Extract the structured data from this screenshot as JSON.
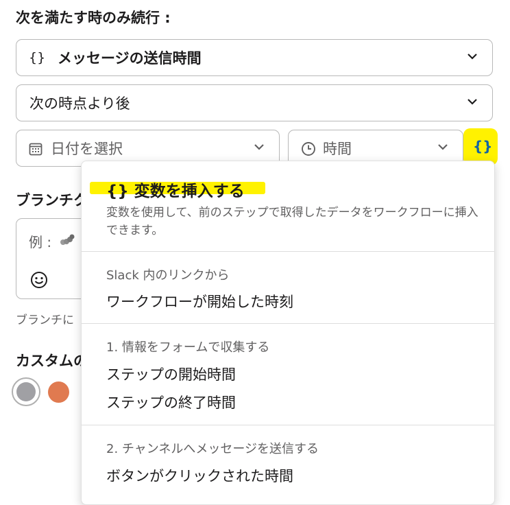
{
  "condition": {
    "label": "次を満たす時のみ続行 :",
    "variable_select": {
      "icon": "{}",
      "value": "メッセージの送信時間"
    },
    "operator_select": {
      "value": "次の時点より後"
    },
    "date_picker": {
      "placeholder": "日付を選択"
    },
    "time_picker": {
      "placeholder": "時間"
    },
    "insert_variable_button": {
      "icon": "{}"
    }
  },
  "branch": {
    "label_partial": "ブランチク",
    "input_placeholder_partial": "例 :",
    "help_text_partial": "ブランチに"
  },
  "custom": {
    "label_partial": "カスタムの",
    "colors": [
      "#a0a0a4",
      "#e07a50"
    ]
  },
  "variable_menu": {
    "title_icon": "{}",
    "title": "変数を挿入する",
    "description": "変数を使用して、前のステップで取得したデータをワークフローに挿入できます。",
    "groups": [
      {
        "title": "Slack 内のリンクから",
        "items": [
          "ワークフローが開始した時刻"
        ]
      },
      {
        "title": "1. 情報をフォームで収集する",
        "items": [
          "ステップの開始時間",
          "ステップの終了時間"
        ]
      },
      {
        "title": "2. チャンネルへメッセージを送信する",
        "items": [
          "ボタンがクリックされた時間"
        ]
      }
    ]
  },
  "colors": {
    "highlight": "#fff200",
    "border": "#b8b8b8",
    "text": "#1d1c1d",
    "muted": "#616061",
    "accent_icon": "#1264a3"
  }
}
